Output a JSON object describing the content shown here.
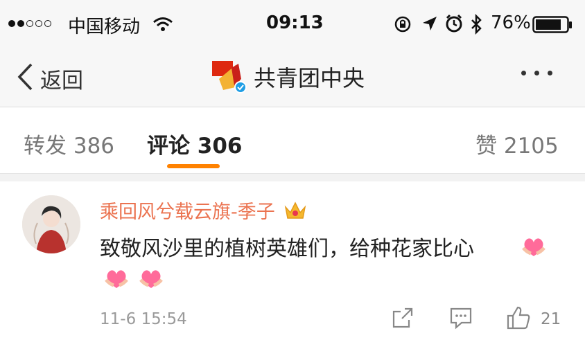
{
  "status": {
    "carrier": "中国移动",
    "time": "09:13",
    "battery": "76%",
    "signal_icon": "signal-dots-icon",
    "wifi_icon": "wifi-icon"
  },
  "nav": {
    "back_label": "返回",
    "title": "共青团中央",
    "more_icon": "more-icon",
    "verified_color": "#1e9ee5"
  },
  "tabs": [
    {
      "label": "转发",
      "count": "386"
    },
    {
      "label": "评论",
      "count": "306"
    },
    {
      "label": "赞",
      "count": "2105"
    }
  ],
  "accent": "#ff8200",
  "comment": {
    "username": "乘回风兮载云旗-季子",
    "text": "致敬风沙里的植树英雄们，给种花家比心",
    "time": "11-6 15:54",
    "likes": "21"
  }
}
